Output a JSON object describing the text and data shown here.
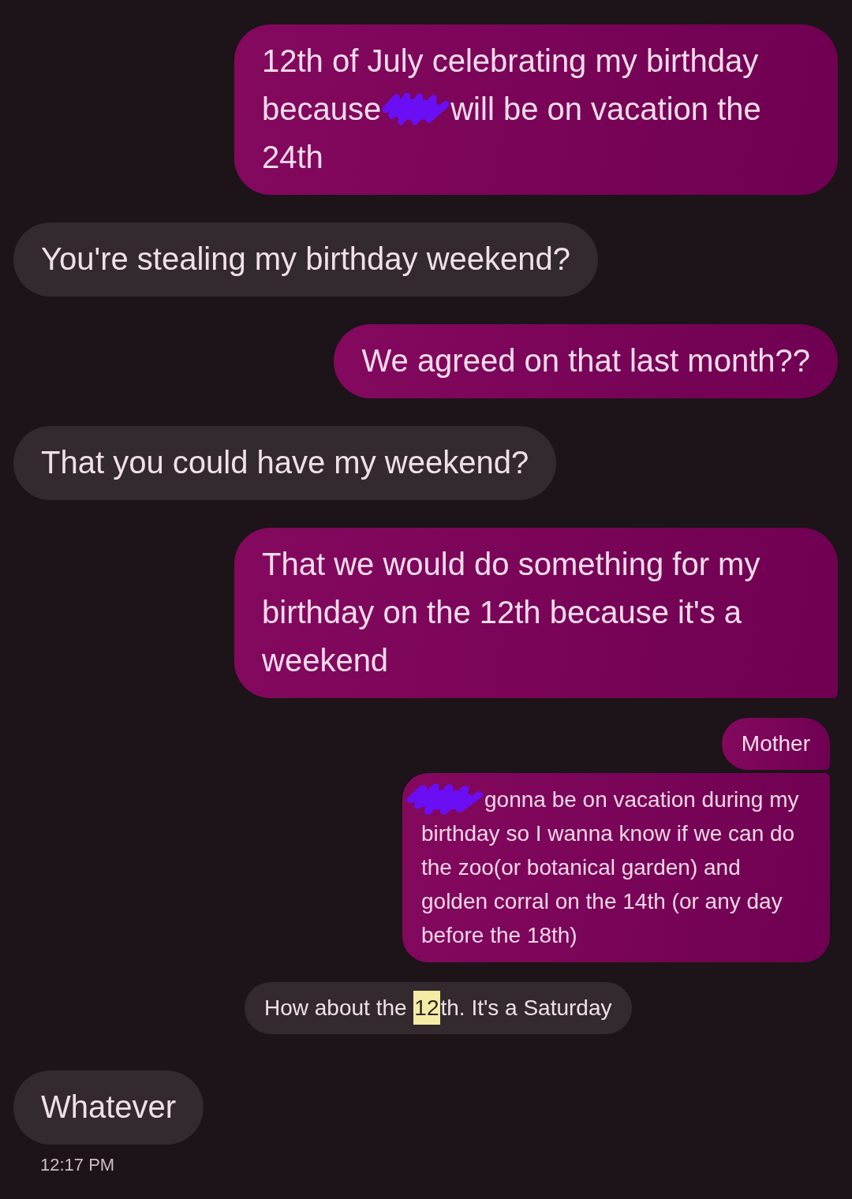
{
  "messages": [
    {
      "kind": "sent",
      "parts": [
        {
          "kind": "text",
          "text": "12th of July celebrating my birthday"
        },
        {
          "kind": "text",
          "text": "because"
        },
        {
          "kind": "scribble"
        },
        {
          "kind": "text",
          "text": "will be on vacation the"
        },
        {
          "kind": "text",
          "text": "24th"
        }
      ]
    },
    {
      "kind": "received",
      "parts": [
        {
          "kind": "text",
          "text": "You're stealing my birthday weekend?"
        }
      ]
    },
    {
      "kind": "sent",
      "parts": [
        {
          "kind": "text",
          "text": "We agreed on that last month??"
        }
      ]
    },
    {
      "kind": "received",
      "parts": [
        {
          "kind": "text",
          "text": "That you could have my weekend?"
        }
      ]
    },
    {
      "kind": "sent",
      "parts": [
        {
          "kind": "text",
          "text": "That we would do something for my birthday on the 12th because it's a weekend"
        }
      ]
    },
    {
      "kind": "received",
      "quote": {
        "label": "Mother",
        "parts": [
          {
            "kind": "scribble"
          },
          {
            "kind": "text",
            "text": "gonna be on vacation during my"
          },
          {
            "kind": "text",
            "text": "birthday so I wanna know if we can do the zoo(or botanical garden) and golden corral on the 14th (or any day before the 18th)"
          }
        ]
      },
      "parts": [
        {
          "kind": "text",
          "text": "How about the "
        },
        {
          "kind": "highlight",
          "text": "12"
        },
        {
          "kind": "text",
          "text": "th. It's a Saturday"
        }
      ]
    },
    {
      "kind": "received",
      "parts": [
        {
          "kind": "text",
          "text": "Whatever"
        }
      ]
    }
  ],
  "timestamp": "12:17 PM"
}
